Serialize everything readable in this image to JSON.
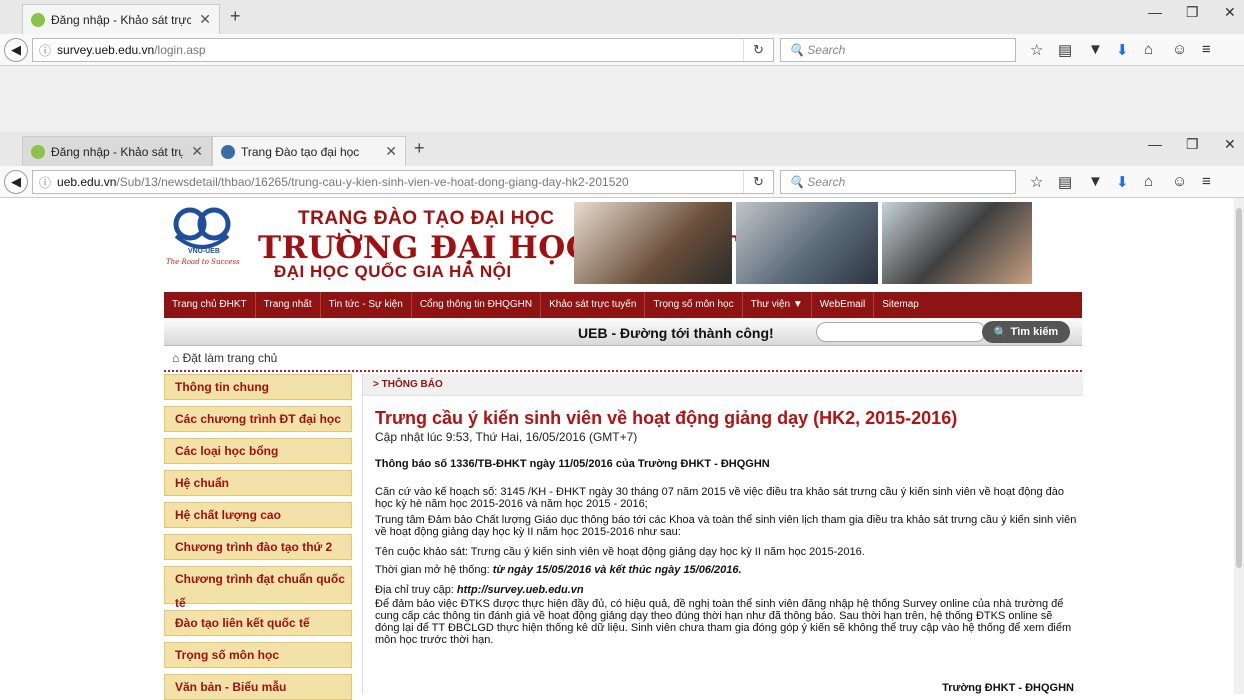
{
  "window1": {
    "tab_title": "Đăng nhập - Khảo sát trực...",
    "url_domain": "survey.ueb.edu.vn",
    "url_path": "/login.asp",
    "search_placeholder": "Search"
  },
  "window2": {
    "tabs": [
      {
        "title": "Đăng nhập - Khảo sát trực..."
      },
      {
        "title": "Trang Đào tạo đại học"
      }
    ],
    "url_domain": "ueb.edu.vn",
    "url_path": "/Sub/13/newsdetail/thbao/16265/trung-cau-y-kien-sinh-vien-ve-hoat-dong-giang-day-hk2-201520",
    "search_placeholder": "Search"
  },
  "site": {
    "logo_caption": "VNU-UEB",
    "logo_tagline": "The Road to Success",
    "header_line1": "TRANG ĐÀO TẠO ĐẠI HỌC",
    "header_line2": "TRƯỜNG ĐẠI HỌC KINH TẾ",
    "header_line3": "ĐẠI HỌC QUỐC GIA HÀ NỘI",
    "menu": [
      "Trang chủ ĐHKT",
      "Trang nhất",
      "Tin tức - Sự kiện",
      "Cổng thông tin ĐHQGHN",
      "Khảo sát trực tuyến",
      "Trọng số môn học",
      "Thư viện ▼",
      "WebEmail",
      "Sitemap"
    ],
    "slogan": "UEB - Đường tới thành công!",
    "search_button": "Tìm kiếm",
    "home_link": "Đặt làm trang chủ",
    "sidebar": [
      "Thông tin chung",
      "Các chương trình ĐT đại học",
      "Các loại học bổng",
      "Hệ chuẩn",
      "Hệ chất lượng cao",
      "Chương trình đào tạo thứ 2",
      "Chương trình đạt chuẩn quốc tế",
      "Đào tạo liên kết quốc tế",
      "Trọng số môn học",
      "Văn bản - Biểu mẫu"
    ]
  },
  "article": {
    "breadcrumb": "> THÔNG BÁO",
    "title": "Trưng cầu ý kiến sinh viên về hoạt động giảng dạy (HK2, 2015-2016)",
    "updated": "Cập nhật lúc 9:53, Thứ Hai, 16/05/2016 (GMT+7)",
    "notice": "Thông báo số 1336/TB-ĐHKT ngày 11/05/2016 của Trường ĐHKT - ĐHQGHN",
    "p1": "Căn cứ vào kế hoạch số: 3145 /KH - ĐHKT ngày 30 tháng 07 năm 2015 về việc điều tra khảo sát trưng cầu ý kiến sinh viên về hoạt động đào học kỳ hè năm học 2015-2016 và năm học 2015 - 2016;",
    "p2": "Trung tâm Đảm bảo Chất lượng Giáo dục thông báo tới các Khoa và toàn thể sinh viên lịch tham gia điều tra khảo sát trưng cầu ý kiến sinh viên về hoạt động giảng dạy học kỳ II năm học 2015-2016 như sau:",
    "p3": "Tên cuộc khảo sát: Trưng cầu ý kiến sinh viên về hoạt động giảng dạy học kỳ II năm học 2015-2016.",
    "p4_label": "Thời gian mở hệ thống: ",
    "p4_value": "từ ngày 15/05/2016 và kết thúc ngày 15/06/2016.",
    "p5_label": "Địa chỉ truy cập:  ",
    "p5_value": "http://survey.ueb.edu.vn",
    "p6": "Để đảm bảo việc ĐTKS được thực hiện đầy đủ, có hiệu quả, đề nghị toàn thể sinh viên đăng nhập hệ thống Survey online của nhà trường để cung cấp các thông tin đánh giá về hoạt động giảng dạy theo đúng thời hạn như đã thông báo. Sau thời hạn trên, hệ thống ĐTKS online sẽ đóng lại để TT ĐBCLGD thực hiện thống kê dữ liệu. Sinh viên chưa tham gia đóng góp ý kiến sẽ không thể truy cập vào hệ thống để xem điểm môn học trước thời hạn.",
    "signature": "Trường ĐHKT - ĐHQGHN"
  }
}
